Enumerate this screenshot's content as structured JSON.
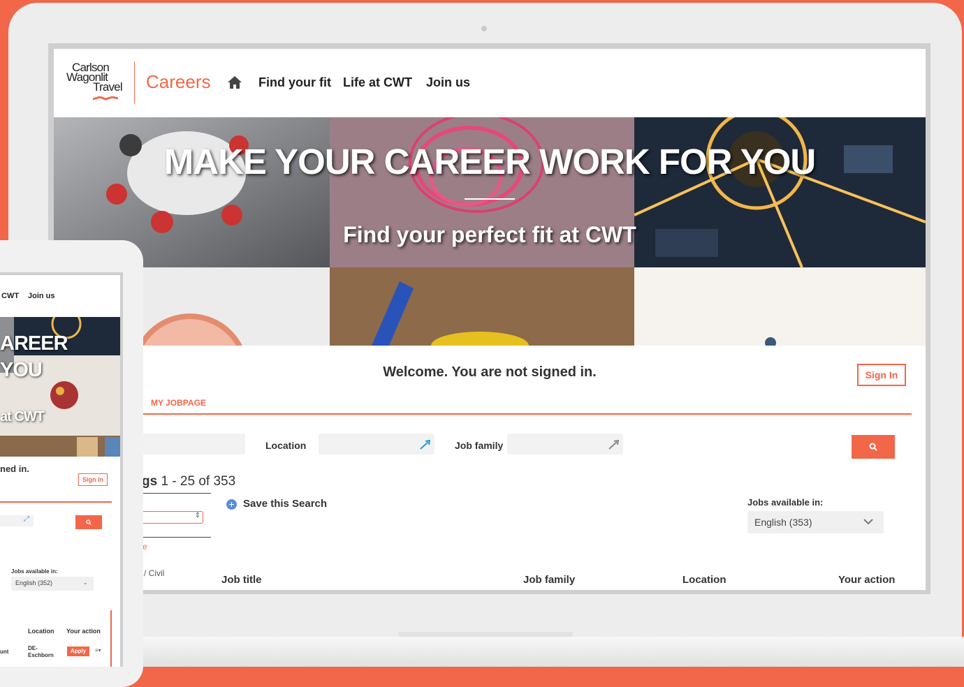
{
  "brand": {
    "logo_lines": [
      "Carlson",
      "Wagonlit",
      "Travel"
    ],
    "careers_label": "Careers",
    "accent_color": "#f26649"
  },
  "nav": {
    "home_icon": "home-icon",
    "items": [
      "Find your fit",
      "Life at CWT",
      "Join us"
    ]
  },
  "hero": {
    "title": "MAKE YOUR CAREER WORK FOR YOU",
    "subtitle": "Find your perfect fit at CWT"
  },
  "account": {
    "welcome": "Welcome. You are not signed in.",
    "sign_in_label": "Sign In"
  },
  "tabs": {
    "my_jobpage": "MY JOBPAGE"
  },
  "search": {
    "location_label": "Location",
    "job_family_label": "Job family",
    "search_icon": "search-icon"
  },
  "results": {
    "count_prefix": "gs",
    "count_text": "1 - 25 of 353",
    "save_search_label": "Save this Search",
    "partial_link": "e",
    "partial_filter": "/ Civil",
    "jobs_available_label": "Jobs available in:",
    "language_option": "English (353)"
  },
  "table": {
    "headers": [
      "Job title",
      "Job family",
      "Location",
      "Your action"
    ]
  },
  "tablet": {
    "nav_items": [
      "CWT",
      "Join us"
    ],
    "hero_lines": [
      "AREER",
      "YOU"
    ],
    "hero_sub": "at CWT",
    "welcome_partial": "ned in.",
    "sign_in_label": "Sign In",
    "jobs_available_label": "Jobs available in:",
    "language_option": "English (352)",
    "headers": [
      "Location",
      "Your action"
    ],
    "row": {
      "partial": "unt",
      "location_line1": "DE-",
      "location_line2": "Eschborn",
      "apply_label": "Apply",
      "menu_glyph": "≡▾"
    }
  }
}
